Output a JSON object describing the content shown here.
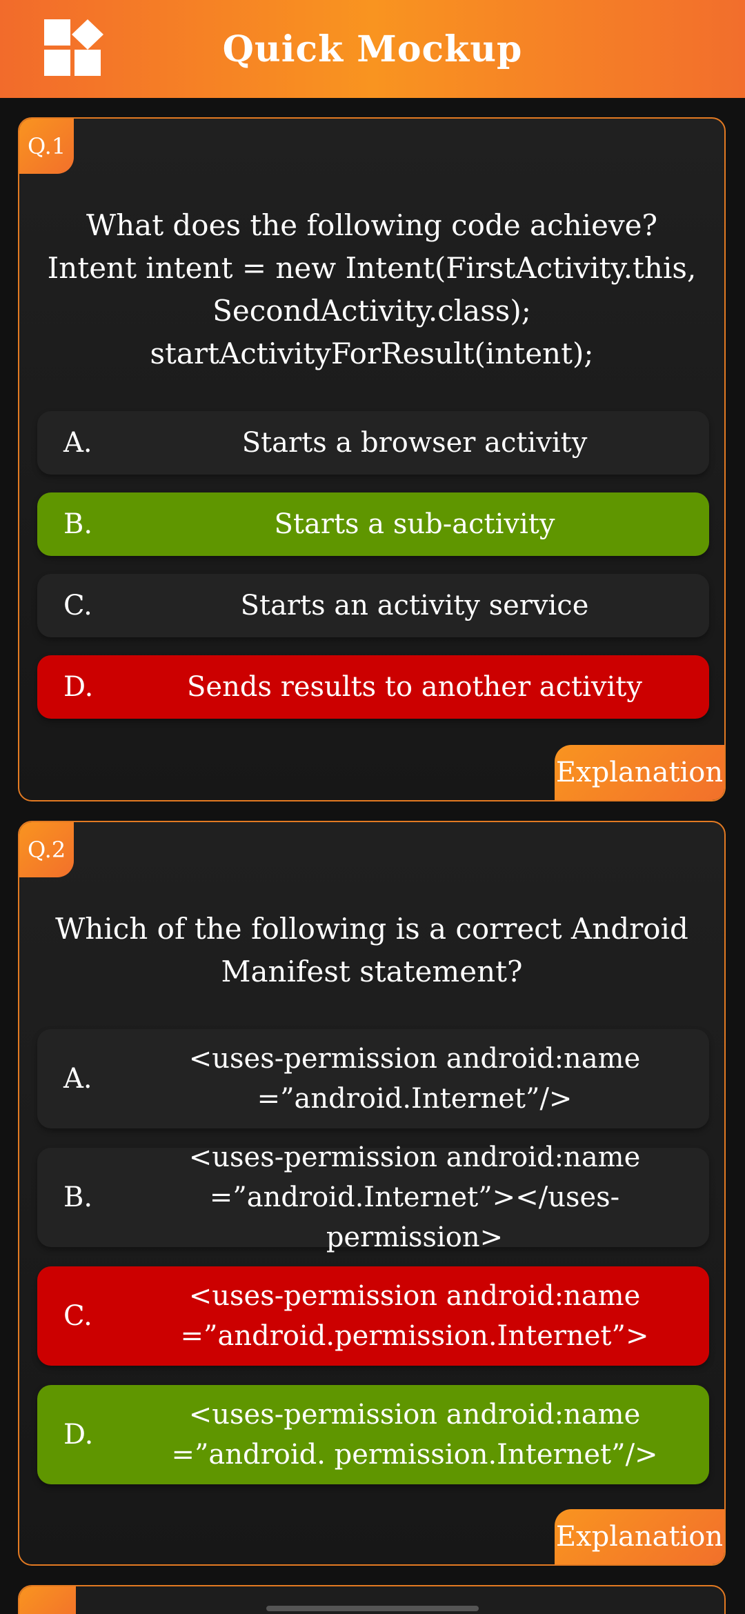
{
  "app": {
    "title": "Quick Mockup",
    "accent_color": "#f99420",
    "correct_color": "#5f9600",
    "wrong_color": "#cc0000"
  },
  "questions": [
    {
      "badge": "Q.1",
      "text": "What does the following code achieve? Intent intent = new Intent(FirstActivity.this, SecondActivity.class); startActivityForResult(intent);",
      "options": [
        {
          "letter": "A.",
          "text": "Starts a browser activity",
          "state": "neutral"
        },
        {
          "letter": "B.",
          "text": "Starts a sub-activity",
          "state": "correct"
        },
        {
          "letter": "C.",
          "text": "Starts an activity service",
          "state": "neutral"
        },
        {
          "letter": "D.",
          "text": "Sends results to another activity",
          "state": "wrong"
        }
      ],
      "explanation_label": "Explanation"
    },
    {
      "badge": "Q.2",
      "text": "Which of the following is a correct Android Manifest statement?",
      "options": [
        {
          "letter": "A.",
          "text": "<uses-permission android:name =”android.Internet”/>",
          "state": "neutral"
        },
        {
          "letter": "B.",
          "text": "<uses-permission android:name =”android.Internet”></uses-permission>",
          "state": "neutral"
        },
        {
          "letter": "C.",
          "text": "<uses-permission android:name =”android.permission.Internet”>",
          "state": "wrong"
        },
        {
          "letter": "D.",
          "text": "<uses-permission android:name =”android. permission.Internet”/>",
          "state": "correct"
        }
      ],
      "explanation_label": "Explanation"
    }
  ]
}
